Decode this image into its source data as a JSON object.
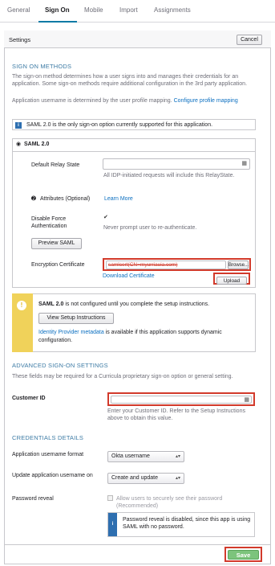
{
  "tabs": [
    "General",
    "Sign On",
    "Mobile",
    "Import",
    "Assignments"
  ],
  "settings": {
    "title": "Settings",
    "cancel": "Cancel"
  },
  "signon": {
    "section": "SIGN ON METHODS",
    "desc": "The sign-on method determines how a user signs into and manages their credentials for an application. Some sign-on methods require additional configuration in the 3rd party application.",
    "mapping_text": "Application username is determined by the user profile mapping.",
    "mapping_link": "Configure profile mapping",
    "info": "SAML 2.0 is the only sign-on option currently supported for this application.",
    "saml_option": "SAML 2.0"
  },
  "saml": {
    "relay_label": "Default Relay State",
    "relay_help": "All IDP-initiated requests will include this RelayState.",
    "attributes_label": "Attributes (Optional)",
    "learn_more": "Learn More",
    "disable_force_label": "Disable Force Authentication",
    "never_prompt": "Never prompt user to re-authenticate.",
    "preview": "Preview SAML",
    "encryption_label": "Encryption Certificate",
    "encryption_value": "samlcert(CN=myurriauia.com)",
    "browse": "Browse...",
    "download": "Download Certificate",
    "upload": "Upload"
  },
  "warning": {
    "saml": "SAML 2.0",
    "text": "is not configured until you complete the setup instructions.",
    "setup_button": "View Setup Instructions",
    "idp_link": "Identity Provider metadata",
    "idp_text": "is available if this application supports dynamic configuration."
  },
  "advanced": {
    "section": "ADVANCED SIGN-ON SETTINGS",
    "desc": "These fields may be required for a Curricula proprietary sign-on option or general setting.",
    "customer_label": "Customer ID",
    "customer_help": "Enter your Customer ID. Refer to the Setup Instructions above to obtain this value."
  },
  "credentials": {
    "section": "CREDENTIALS DETAILS",
    "username_format_label": "Application username format",
    "username_format_value": "Okta username",
    "update_label": "Update application username on",
    "update_value": "Create and update",
    "password_reveal_label": "Password reveal",
    "password_reveal_option": "Allow users to securely see their password (Recommended)",
    "password_info": "Password reveal is disabled, since this app is using SAML with no password."
  },
  "footer": {
    "save": "Save"
  },
  "colors": {
    "accent": "#0b6fc0",
    "save_green": "#7cc47c",
    "warning_yellow": "#f0d25a",
    "highlight_red": "#d23a2b"
  }
}
